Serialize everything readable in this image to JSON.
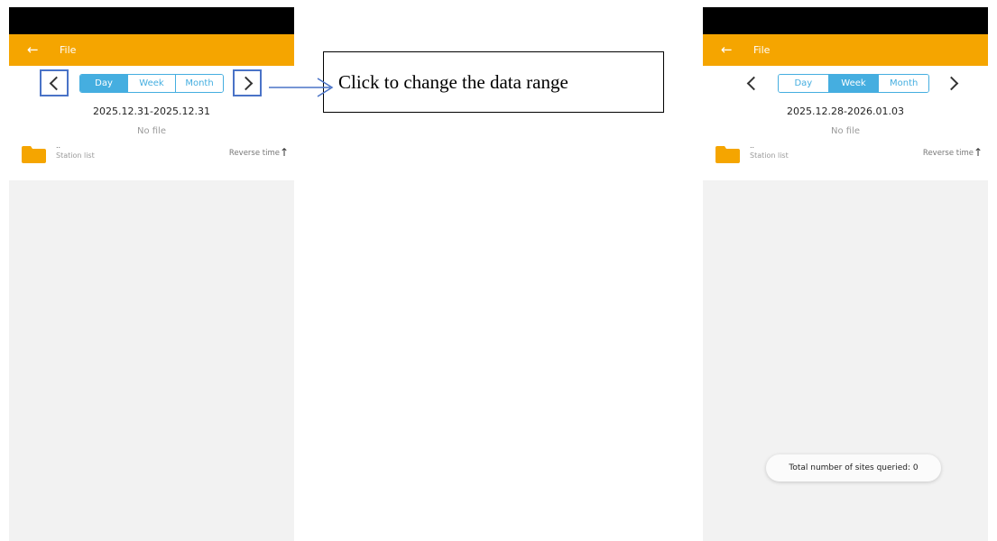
{
  "colors": {
    "header": "#f5a500",
    "accent": "#45aee0",
    "folder": "#f5a500",
    "highlight_box": "#4a73c7",
    "status_bar": "#000000"
  },
  "screens": {
    "left": {
      "title": "File",
      "back_icon": "arrow-left-icon",
      "prev_icon": "chevron-left-icon",
      "next_icon": "chevron-right-icon",
      "tabs": [
        "Day",
        "Week",
        "Month"
      ],
      "active_tab": "Day",
      "date_range": "2025.12.31-2025.12.31",
      "empty_message": "No file",
      "folder": {
        "dots": "..",
        "label": "Station list"
      },
      "sort_label": "Reverse time",
      "sort_icon": "arrow-up-icon"
    },
    "right": {
      "title": "File",
      "back_icon": "arrow-left-icon",
      "prev_icon": "chevron-left-icon",
      "next_icon": "chevron-right-icon",
      "tabs": [
        "Day",
        "Week",
        "Month"
      ],
      "active_tab": "Week",
      "date_range": "2025.12.28-2026.01.03",
      "empty_message": "No file",
      "folder": {
        "dots": "..",
        "label": "Station list"
      },
      "sort_label": "Reverse time",
      "sort_icon": "arrow-up-icon",
      "toast": "Total number of sites queried: 0"
    }
  },
  "annotation": {
    "text": "Click to change the data range"
  }
}
